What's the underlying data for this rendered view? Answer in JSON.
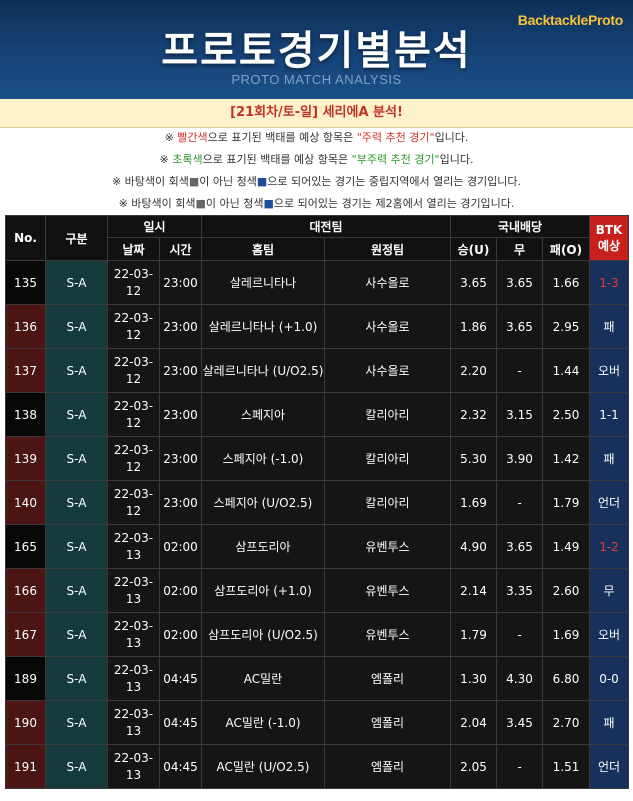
{
  "banner": {
    "logo": "BacktackleProto",
    "title": "프로토경기별분석",
    "subtitle": "PROTO MATCH ANALYSIS"
  },
  "round_title": "[21회차/토-일] 세리에A 분석!",
  "notes": {
    "n1": {
      "pre": "※ ",
      "hl1": "빨간색",
      "mid": "으로 표기된 백태를 예상 항목은 ",
      "hl2": "\"주력 추천 경기\"",
      "post": "입니다."
    },
    "n2": {
      "pre": "※ ",
      "hl1": "초록색",
      "mid": "으로 표기된 백태를 예상 항목은 ",
      "hl2": "\"부주력 추천 경기\"",
      "post": "입니다."
    },
    "n3": {
      "a": "※ 바탕색이 회색",
      "sq1": "■",
      "b": "이 아닌 청색",
      "sq2": "■",
      "c": "으로 되어있는 경기는 중립지역에서 열리는 경기입니다."
    },
    "n4": {
      "a": "※ 바탕색이 회색",
      "sq1": "■",
      "b": "이 아닌 청색",
      "sq2": "■",
      "c": "으로 되어있는 경기는 제2홈에서 열리는 경기입니다."
    }
  },
  "table": {
    "headers": {
      "no": "No.",
      "category": "구분",
      "datetime": "일시",
      "date": "날짜",
      "time": "시간",
      "teams": "대전팀",
      "home": "홈팀",
      "away": "원정팀",
      "odds": "국내배당",
      "win": "승(U)",
      "draw": "무",
      "lose": "패(O)",
      "btk": "BTK",
      "btk_sub": "예상"
    },
    "rows": [
      {
        "no": "135",
        "cat": "S-A",
        "date1": "22-03-",
        "date2": "12",
        "time": "23:00",
        "home": "살레르니타나",
        "away": "사수올로",
        "w": "3.65",
        "d": "3.65",
        "l": "1.66",
        "btk": "1-3",
        "btk_red": true,
        "shade": "dark"
      },
      {
        "no": "136",
        "cat": "S-A",
        "date1": "22-03-",
        "date2": "12",
        "time": "23:00",
        "home": "살레르니타나 (+1.0)",
        "away": "사수올로",
        "w": "1.86",
        "d": "3.65",
        "l": "2.95",
        "btk": "패",
        "btk_red": false,
        "shade": "maroon"
      },
      {
        "no": "137",
        "cat": "S-A",
        "date1": "22-03-",
        "date2": "12",
        "time": "23:00",
        "home": "살레르니타나 (U/O2.5)",
        "away": "사수올로",
        "w": "2.20",
        "d": "-",
        "l": "1.44",
        "btk": "오버",
        "btk_red": false,
        "shade": "maroon"
      },
      {
        "no": "138",
        "cat": "S-A",
        "date1": "22-03-",
        "date2": "12",
        "time": "23:00",
        "home": "스페지아",
        "away": "칼리아리",
        "w": "2.32",
        "d": "3.15",
        "l": "2.50",
        "btk": "1-1",
        "btk_red": false,
        "shade": "dark"
      },
      {
        "no": "139",
        "cat": "S-A",
        "date1": "22-03-",
        "date2": "12",
        "time": "23:00",
        "home": "스페지아 (-1.0)",
        "away": "칼리아리",
        "w": "5.30",
        "d": "3.90",
        "l": "1.42",
        "btk": "패",
        "btk_red": false,
        "shade": "maroon"
      },
      {
        "no": "140",
        "cat": "S-A",
        "date1": "22-03-",
        "date2": "12",
        "time": "23:00",
        "home": "스페지아 (U/O2.5)",
        "away": "칼리아리",
        "w": "1.69",
        "d": "-",
        "l": "1.79",
        "btk": "언더",
        "btk_red": false,
        "shade": "maroon"
      },
      {
        "no": "165",
        "cat": "S-A",
        "date1": "22-03-",
        "date2": "13",
        "time": "02:00",
        "home": "삼프도리아",
        "away": "유벤투스",
        "w": "4.90",
        "d": "3.65",
        "l": "1.49",
        "btk": "1-2",
        "btk_red": true,
        "shade": "dark"
      },
      {
        "no": "166",
        "cat": "S-A",
        "date1": "22-03-",
        "date2": "13",
        "time": "02:00",
        "home": "삼프도리아 (+1.0)",
        "away": "유벤투스",
        "w": "2.14",
        "d": "3.35",
        "l": "2.60",
        "btk": "무",
        "btk_red": false,
        "shade": "maroon"
      },
      {
        "no": "167",
        "cat": "S-A",
        "date1": "22-03-",
        "date2": "13",
        "time": "02:00",
        "home": "삼프도리아 (U/O2.5)",
        "away": "유벤투스",
        "w": "1.79",
        "d": "-",
        "l": "1.69",
        "btk": "오버",
        "btk_red": false,
        "shade": "maroon"
      },
      {
        "no": "189",
        "cat": "S-A",
        "date1": "22-03-",
        "date2": "13",
        "time": "04:45",
        "home": "AC밀란",
        "away": "엠폴리",
        "w": "1.30",
        "d": "4.30",
        "l": "6.80",
        "btk": "0-0",
        "btk_red": false,
        "shade": "dark"
      },
      {
        "no": "190",
        "cat": "S-A",
        "date1": "22-03-",
        "date2": "13",
        "time": "04:45",
        "home": "AC밀란 (-1.0)",
        "away": "엠폴리",
        "w": "2.04",
        "d": "3.45",
        "l": "2.70",
        "btk": "패",
        "btk_red": false,
        "shade": "maroon"
      },
      {
        "no": "191",
        "cat": "S-A",
        "date1": "22-03-",
        "date2": "13",
        "time": "04:45",
        "home": "AC밀란 (U/O2.5)",
        "away": "엠폴리",
        "w": "2.05",
        "d": "-",
        "l": "1.51",
        "btk": "언더",
        "btk_red": false,
        "shade": "maroon"
      }
    ]
  }
}
